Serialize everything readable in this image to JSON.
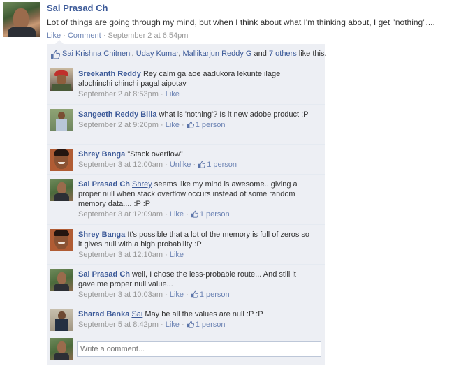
{
  "post": {
    "author": "Sai Prasad Ch",
    "text": "Lot of things are going through my mind, but when I think about what I'm thinking about, I get \"nothing\"....",
    "like_label": "Like",
    "comment_label": "Comment",
    "timestamp": "September 2 at 6:54pm"
  },
  "likes": {
    "name1": "Sai Krishna Chitneni",
    "sep1": ", ",
    "name2": "Uday Kumar",
    "sep2": ", ",
    "name3": "Mallikarjun Reddy G",
    "and": " and ",
    "others": "7 others",
    "suffix": " like this."
  },
  "comments": [
    {
      "author": "Sreekanth Reddy",
      "text": "Rey calm ga aoe aadukora lekunte ilage alochinchi chinchi pagal aipotav",
      "timestamp": "September 2 at 8:53pm",
      "action": "Like"
    },
    {
      "author": "Sangeeth Reddy Billa",
      "text": "what is 'nothing'? Is it new adobe product :P",
      "timestamp": "September 2 at 9:20pm",
      "action": "Like",
      "likes": "1 person"
    },
    {
      "author": "Shrey Banga",
      "text": "\"Stack overflow\"",
      "timestamp": "September 3 at 12:00am",
      "action": "Unlike",
      "likes": "1 person"
    },
    {
      "author": "Sai Prasad Ch",
      "mention": "Shrey",
      "text": "seems like my mind is awesome.. giving a proper null when stack overflow occurs instead of some random memory data.... :P :P",
      "timestamp": "September 3 at 12:09am",
      "action": "Like",
      "likes": "1 person"
    },
    {
      "author": "Shrey Banga",
      "text": "It's possible that a lot of the memory is full of zeros so it gives null with a high probability :P",
      "timestamp": "September 3 at 12:10am",
      "action": "Like"
    },
    {
      "author": "Sai Prasad Ch",
      "text": "well, I chose the less-probable route... And still it gave me proper null value...",
      "timestamp": "September 3 at 10:03am",
      "action": "Like",
      "likes": "1 person"
    },
    {
      "author": "Sharad Banka",
      "mention": "Sai",
      "text": "May be all the values are null :P :P",
      "timestamp": "September 5 at 8:42pm",
      "action": "Like",
      "likes": "1 person"
    }
  ],
  "composer": {
    "placeholder": "Write a comment..."
  },
  "meta_separator": " · ",
  "icons": {
    "like": "thumbs-up-icon"
  },
  "colors": {
    "link": "#3b5998",
    "meta_link": "#6d84b4",
    "panel_bg": "#edeff4",
    "timestamp": "#999999"
  }
}
